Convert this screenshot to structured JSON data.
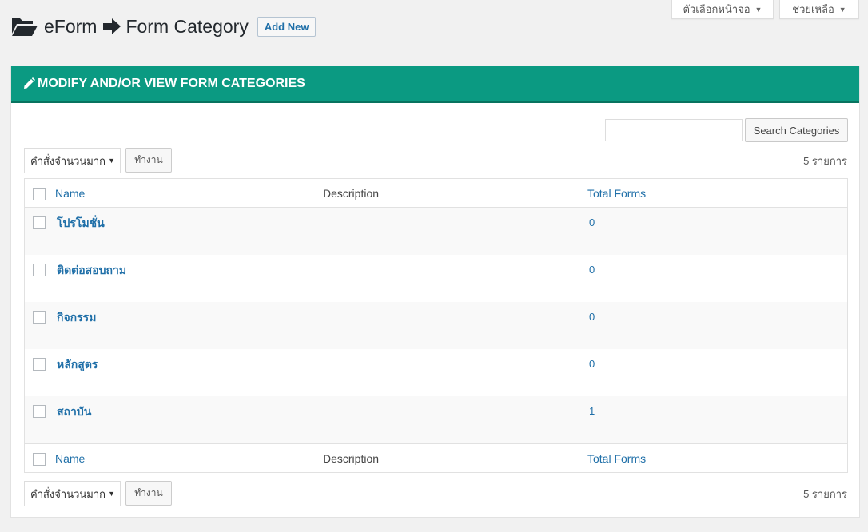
{
  "screen_tabs": {
    "screen_options": "ตัวเลือกหน้าจอ",
    "help": "ช่วยเหลือ"
  },
  "header": {
    "breadcrumb_root": "eForm",
    "breadcrumb_current": "Form Category",
    "add_new": "Add New"
  },
  "panel": {
    "title": "MODIFY AND/OR VIEW FORM CATEGORIES"
  },
  "search": {
    "value": "",
    "button": "Search Categories"
  },
  "bulk": {
    "selected": "คำสั่งจำนวนมาก",
    "apply": "ทำงาน",
    "count": "5 รายการ"
  },
  "table": {
    "columns": {
      "name": "Name",
      "description": "Description",
      "total": "Total Forms"
    },
    "rows": [
      {
        "name": "โปรโมชั่น",
        "description": "",
        "total": "0"
      },
      {
        "name": "ติดต่อสอบถาม",
        "description": "",
        "total": "0"
      },
      {
        "name": "กิจกรรม",
        "description": "",
        "total": "0"
      },
      {
        "name": "หลักสูตร",
        "description": "",
        "total": "0"
      },
      {
        "name": "สถาบัน",
        "description": "",
        "total": "1"
      }
    ]
  },
  "colors": {
    "panel_header": "#0b9a82",
    "link": "#1f6fa8"
  }
}
